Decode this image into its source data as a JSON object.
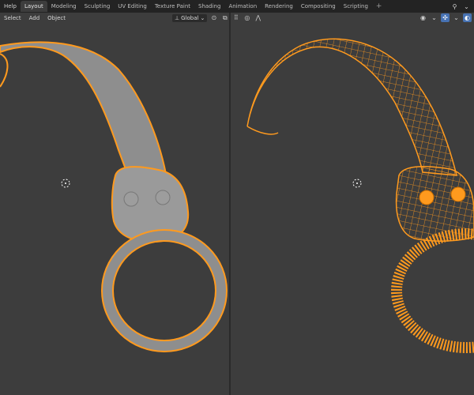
{
  "topbar": {
    "menu": [
      "Help"
    ],
    "tabs": [
      "Layout",
      "Modeling",
      "Sculpting",
      "UV Editing",
      "Texture Paint",
      "Shading",
      "Animation",
      "Rendering",
      "Compositing",
      "Scripting"
    ],
    "active_tab": "Layout",
    "add_tab": "+"
  },
  "header": {
    "menu": [
      "Select",
      "Add",
      "Object"
    ],
    "transform_orientation": "Global"
  },
  "colors": {
    "selection_outline": "#ff9a1e",
    "mesh_fill": "#8c8c8c",
    "background": "#3d3d3d"
  },
  "icons": {
    "cursor": "3d-cursor-icon",
    "overlay": "overlay-icon",
    "gizmo": "gizmo-icon"
  }
}
